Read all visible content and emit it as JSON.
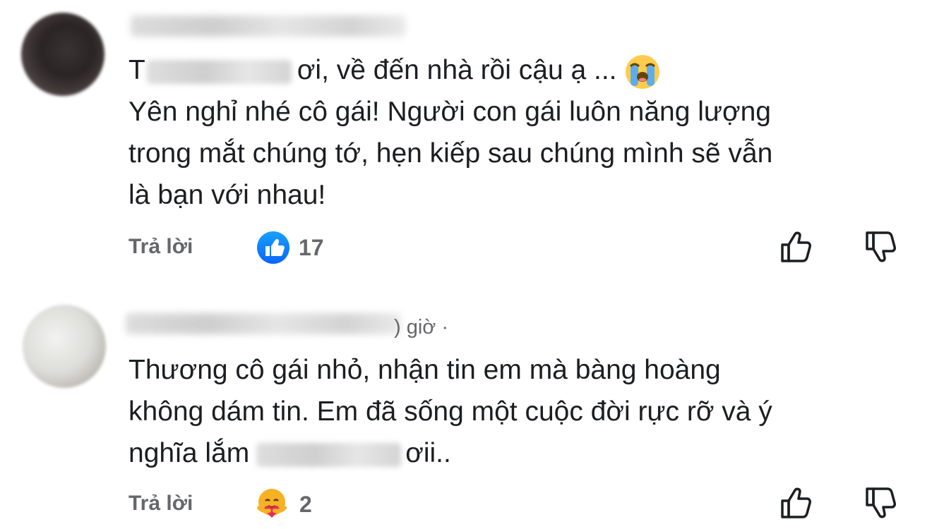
{
  "comments": [
    {
      "time": "",
      "text_lines": [
        {
          "before": "T",
          "after": "ơi, về đến nhà rồi cậu ạ ..."
        },
        "Yên nghỉ nhé cô gái! Người con gái luôn năng lượng",
        "trong mắt chúng tớ, hẹn kiếp sau chúng mình sẽ vẫn",
        "là bạn với nhau!"
      ],
      "reply_label": "Trả lời",
      "reaction_icon": "like-icon",
      "reaction_count": "17"
    },
    {
      "time": ") giờ ·",
      "text_lines": [
        "Thương cô gái nhỏ, nhận tin em mà bàng hoàng",
        "không dám tin. Em đã sống một cuộc đời rực rỡ và ý",
        {
          "before": "nghĩa lắm",
          "after": "ơii.."
        }
      ],
      "reply_label": "Trả lời",
      "reaction_icon": "care-icon",
      "reaction_count": "2"
    }
  ],
  "colors": {
    "text": "#1c1e21",
    "secondary": "#65676b",
    "like_blue": "#0866ff"
  }
}
